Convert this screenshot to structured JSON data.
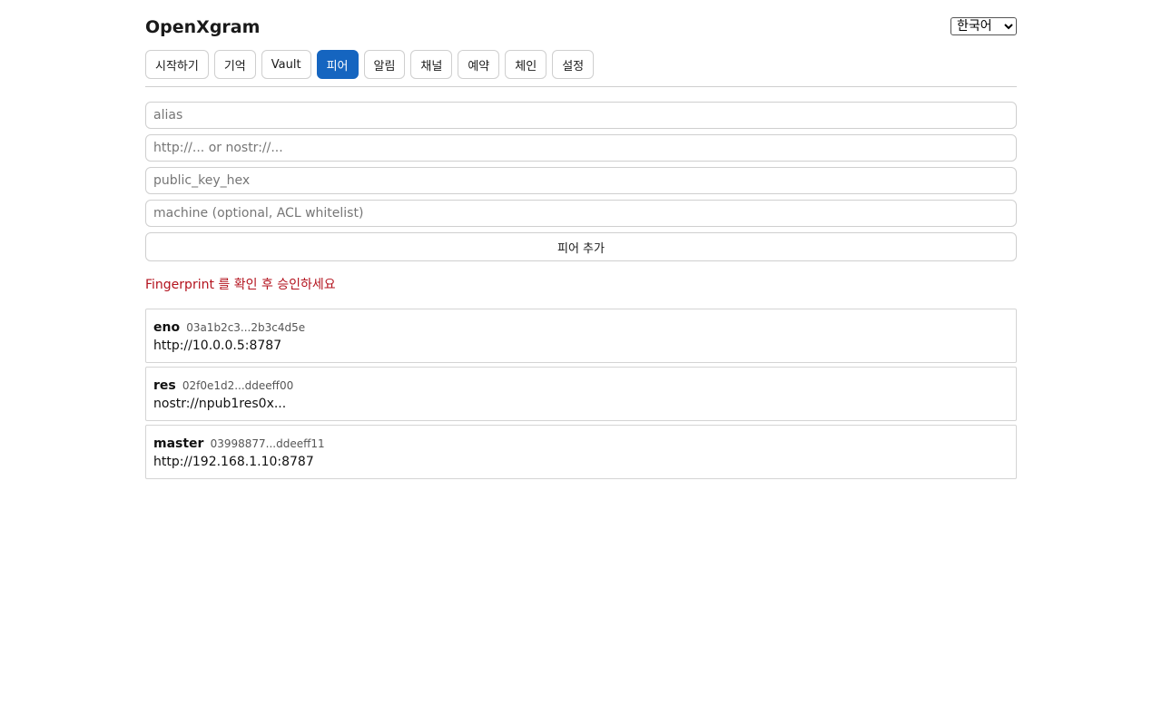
{
  "header": {
    "title": "OpenXgram",
    "language": {
      "selected": "한국어",
      "options": [
        "한국어"
      ]
    }
  },
  "tabs": [
    {
      "label": "시작하기",
      "active": false
    },
    {
      "label": "기억",
      "active": false
    },
    {
      "label": "Vault",
      "active": false
    },
    {
      "label": "피어",
      "active": true
    },
    {
      "label": "알림",
      "active": false
    },
    {
      "label": "채널",
      "active": false
    },
    {
      "label": "예약",
      "active": false
    },
    {
      "label": "체인",
      "active": false
    },
    {
      "label": "설정",
      "active": false
    }
  ],
  "form": {
    "alias_placeholder": "alias",
    "address_placeholder": "http://... or nostr://...",
    "pubkey_placeholder": "public_key_hex",
    "machine_placeholder": "machine (optional, ACL whitelist)",
    "submit_label": "피어 추가"
  },
  "notice": "Fingerprint 를 확인 후 승인하세요",
  "peers": [
    {
      "alias": "eno",
      "fingerprint": "03a1b2c3...2b3c4d5e",
      "endpoint": "http://10.0.0.5:8787"
    },
    {
      "alias": "res",
      "fingerprint": "02f0e1d2...ddeeff00",
      "endpoint": "nostr://npub1res0x..."
    },
    {
      "alias": "master",
      "fingerprint": "03998877...ddeeff11",
      "endpoint": "http://192.168.1.10:8787"
    }
  ],
  "colors": {
    "accent": "#1565c0",
    "notice": "#b3121d",
    "border": "#cfcfcf"
  }
}
